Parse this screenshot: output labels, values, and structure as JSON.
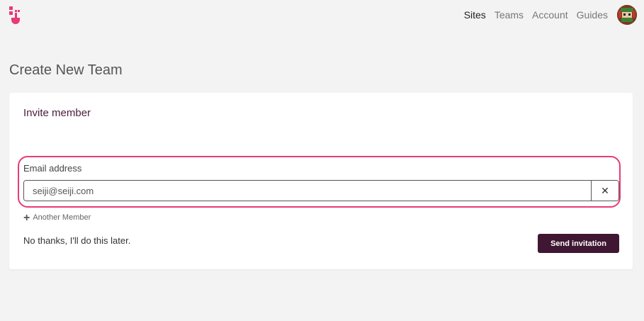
{
  "nav": {
    "items": [
      {
        "label": "Sites",
        "active": true
      },
      {
        "label": "Teams",
        "active": false
      },
      {
        "label": "Account",
        "active": false
      },
      {
        "label": "Guides",
        "active": false
      }
    ]
  },
  "logo": {
    "icon": "brand-logo-icon",
    "color": "#e83a78"
  },
  "avatar": {
    "icon": "pixel-avatar-icon"
  },
  "page": {
    "title": "Create New Team"
  },
  "invite": {
    "section_title": "Invite member",
    "email_label": "Email address",
    "email_value": "seiji@seiji.com",
    "clear_icon": "close-icon",
    "another_member": "Another Member",
    "another_icon": "plus-icon",
    "skip_text": "No thanks, I'll do this later.",
    "send_button": "Send invitation"
  },
  "colors": {
    "accent": "#e83a78",
    "primary_button": "#3f1732",
    "background": "#f4f3f3"
  }
}
